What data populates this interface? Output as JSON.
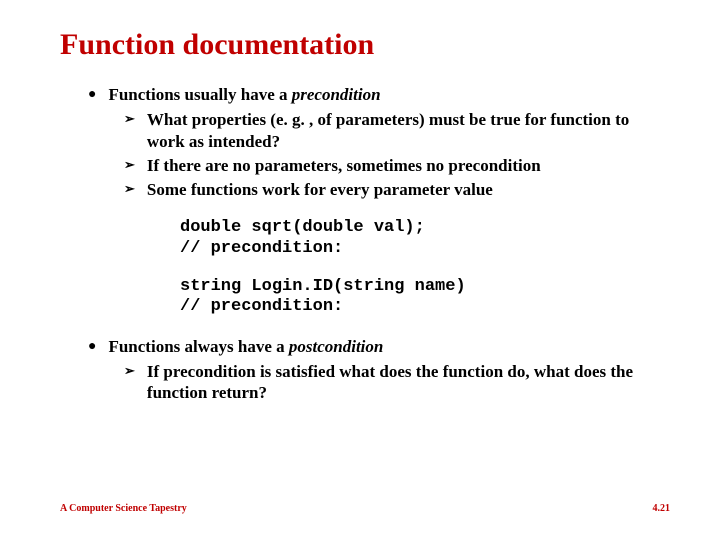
{
  "title": "Function documentation",
  "b1": {
    "lead": "Functions usually have a ",
    "em": "precondition",
    "s1": "What properties (e. g. , of parameters) must be true for function to work as intended?",
    "s2": "If there are no parameters, sometimes no precondition",
    "s3": "Some functions work for every parameter value"
  },
  "code1": "double sqrt(double val);\n// precondition:",
  "code2": "string Login.ID(string name)\n// precondition:",
  "b2": {
    "lead": "Functions always have a ",
    "em": "postcondition",
    "s1": "If precondition is satisfied what does the function do, what does the function return?"
  },
  "footer": {
    "left": "A Computer Science Tapestry",
    "right": "4.21"
  },
  "glyph": {
    "dot": "●",
    "arrow": "➢"
  }
}
